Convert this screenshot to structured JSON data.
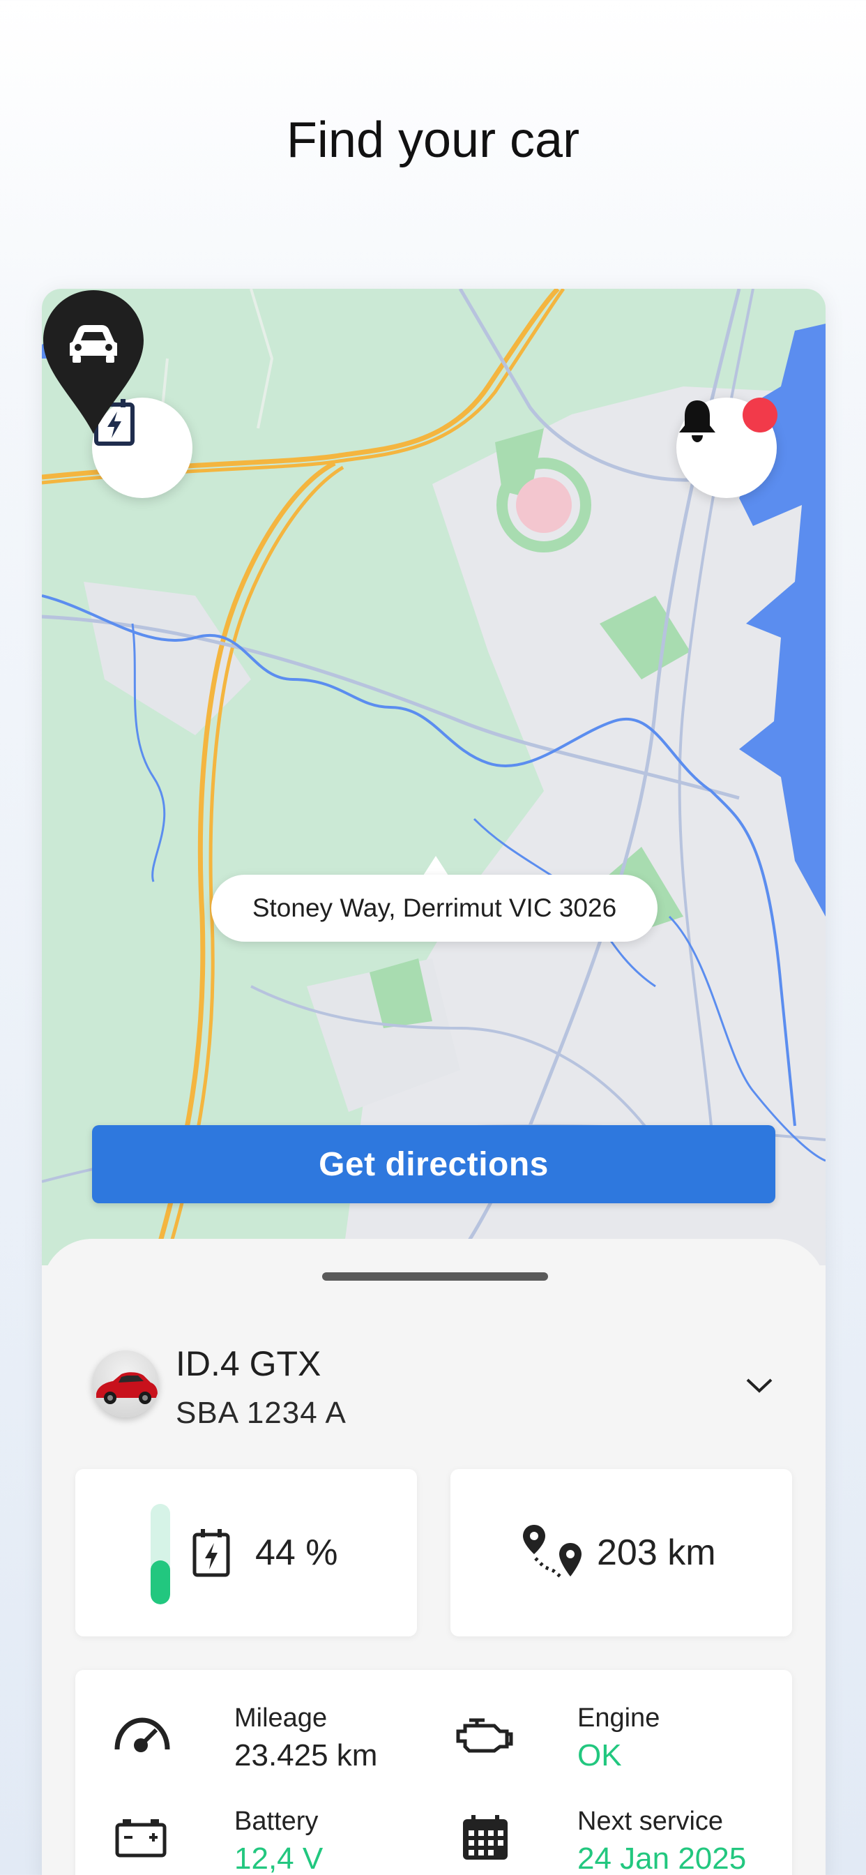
{
  "header": {
    "title": "Find your car"
  },
  "map": {
    "address": "Stoney Way, Derrimut VIC 3026",
    "directions_label": "Get directions",
    "icons": [
      "charging-icon",
      "bell-icon",
      "car-pin-icon"
    ]
  },
  "vehicle": {
    "model": "ID.4 GTX",
    "plate": "SBA 1234 A",
    "battery_percent": 44,
    "battery_label": "44 %",
    "range_label": "203 km"
  },
  "details": {
    "mileage": {
      "label": "Mileage",
      "value": "23.425 km"
    },
    "engine": {
      "label": "Engine",
      "value": "OK"
    },
    "battery": {
      "label": "Battery",
      "value": "12,4 V"
    },
    "service": {
      "label": "Next service",
      "value": "24 Jan 2025"
    }
  },
  "colors": {
    "primary": "#2e78de",
    "ok_green": "#22c77f",
    "notification": "#f23a4a",
    "map_green": "#cbe9d5",
    "water": "#5b8def"
  }
}
